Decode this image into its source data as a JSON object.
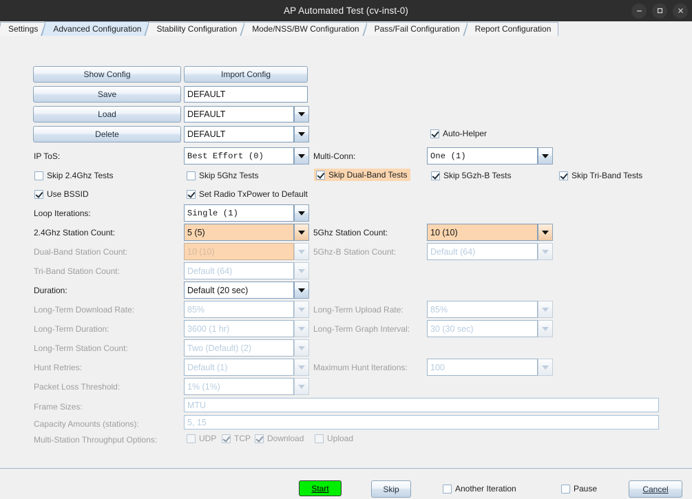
{
  "window": {
    "title": "AP Automated Test (cv-inst-0)",
    "controls": [
      {
        "name": "minimize-button",
        "glyph": "minimize"
      },
      {
        "name": "maximize-button",
        "glyph": "maximize"
      },
      {
        "name": "close-button",
        "glyph": "close"
      }
    ]
  },
  "tabs": [
    {
      "label": "Settings",
      "selected": false
    },
    {
      "label": "Advanced Configuration",
      "selected": true
    },
    {
      "label": "Stability Configuration",
      "selected": false
    },
    {
      "label": "Mode/NSS/BW Configuration",
      "selected": false
    },
    {
      "label": "Pass/Fail Configuration",
      "selected": false
    },
    {
      "label": "Report Configuration",
      "selected": false
    }
  ],
  "config_actions": {
    "show_config": "Show Config",
    "import_config": "Import Config",
    "save": "Save",
    "save_value": "DEFAULT",
    "load": "Load",
    "load_value": "DEFAULT",
    "delete": "Delete",
    "delete_value": "DEFAULT"
  },
  "auto_helper": {
    "label": "Auto-Helper",
    "checked": true
  },
  "ip_tos": {
    "label": "IP ToS:",
    "value": "Best Effort     (0)"
  },
  "multi_conn": {
    "label": "Multi-Conn:",
    "value": "One (1)"
  },
  "skip_tests": [
    {
      "label": "Skip 2.4Ghz Tests",
      "checked": false,
      "highlight": false
    },
    {
      "label": "Skip 5Ghz Tests",
      "checked": false,
      "highlight": false
    },
    {
      "label": "Skip Dual-Band Tests",
      "checked": true,
      "highlight": true
    },
    {
      "label": "Skip 5Gzh-B Tests",
      "checked": true,
      "highlight": false
    },
    {
      "label": "Skip Tri-Band Tests",
      "checked": true,
      "highlight": false
    }
  ],
  "use_bssid": {
    "label": "Use BSSID",
    "checked": true
  },
  "set_radio_txpower": {
    "label": "Set Radio TxPower to Default",
    "checked": true
  },
  "loop_iterations": {
    "label": "Loop Iterations:",
    "value": "Single        (1)"
  },
  "station_counts": {
    "g24_label": "2.4Ghz Station Count:",
    "g24_value": "5 (5)",
    "g5_label": "5Ghz Station Count:",
    "g5_value": "10 (10)",
    "dual_label": "Dual-Band Station Count:",
    "dual_value": "10 (10)",
    "g5b_label": "5Ghz-B Station Count:",
    "g5b_value": "Default (64)",
    "tri_label": "Tri-Band Station Count:",
    "tri_value": "Default (64)"
  },
  "duration": {
    "label": "Duration:",
    "value": "Default (20 sec)"
  },
  "long_term": {
    "download_rate_label": "Long-Term Download Rate:",
    "download_rate_value": "85%",
    "upload_rate_label": "Long-Term Upload Rate:",
    "upload_rate_value": "85%",
    "duration_label": "Long-Term Duration:",
    "duration_value": "3600 (1 hr)",
    "graph_interval_label": "Long-Term Graph Interval:",
    "graph_interval_value": "30 (30 sec)",
    "station_count_label": "Long-Term Station Count:",
    "station_count_value": "Two (Default) (2)"
  },
  "hunt": {
    "retries_label": "Hunt Retries:",
    "retries_value": "Default (1)",
    "max_iter_label": "Maximum Hunt Iterations:",
    "max_iter_value": "100"
  },
  "packet_loss": {
    "label": "Packet Loss Threshold:",
    "value": "1% (1%)"
  },
  "frame_sizes": {
    "label": "Frame Sizes:",
    "value": "MTU"
  },
  "capacity": {
    "label": "Capacity Amounts (stations):",
    "value": "5, 15"
  },
  "multi_station": {
    "label": "Multi-Station Throughput Options:",
    "options": [
      {
        "label": "UDP",
        "checked": false
      },
      {
        "label": "TCP",
        "checked": true
      },
      {
        "label": "Download",
        "checked": true
      },
      {
        "label": "Upload",
        "checked": false
      }
    ]
  },
  "footer": {
    "start": "Start",
    "skip": "Skip",
    "another_iteration": "Another Iteration",
    "another_iteration_checked": false,
    "pause": "Pause",
    "pause_checked": false,
    "cancel": "Cancel"
  },
  "colors": {
    "titlebar": "#2e2e2e",
    "background": "#f0f0f0",
    "selected_tab": "#dbe9f7",
    "highlight": "#fbd6b0",
    "start_green": "#00ee00",
    "border": "#9cb4cc"
  }
}
